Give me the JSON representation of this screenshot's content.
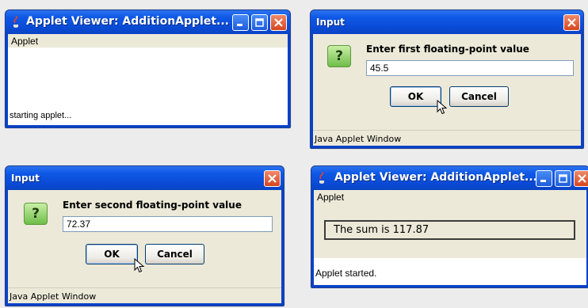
{
  "windows": {
    "applet_start": {
      "title": "Applet Viewer: AdditionApplet...",
      "menu": "Applet",
      "status": "starting applet..."
    },
    "input_first": {
      "title": "Input",
      "prompt": "Enter first floating-point value",
      "value": "45.5",
      "ok_label": "OK",
      "cancel_label": "Cancel",
      "footer": "Java Applet Window"
    },
    "input_second": {
      "title": "Input",
      "prompt": "Enter second floating-point value",
      "value": "72.37",
      "ok_label": "OK",
      "cancel_label": "Cancel",
      "footer": "Java Applet Window"
    },
    "applet_result": {
      "title": "Applet Viewer: AdditionApplet...",
      "menu": "Applet",
      "result": "The sum is 117.87",
      "status": "Applet started."
    }
  },
  "icons": {
    "question": "?",
    "java": "java-cup-icon",
    "minimize": "minimize-icon",
    "maximize": "maximize-icon",
    "close": "close-icon",
    "cursor": "mouse-pointer-icon"
  },
  "colors": {
    "titlebar": "#0a4ad4",
    "dialog_bg": "#ece9d8",
    "close_button": "#d6461f",
    "question_icon": "#6fbd49"
  }
}
